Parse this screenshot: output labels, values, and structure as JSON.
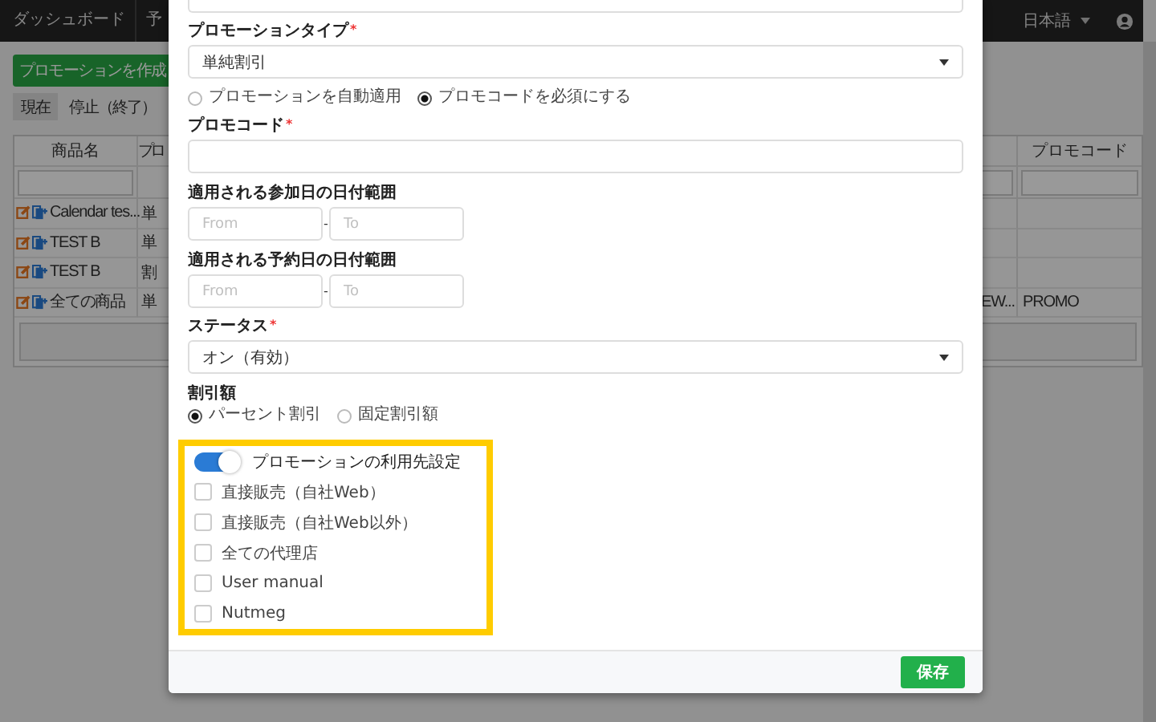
{
  "navbar": {
    "items": [
      {
        "label": "ダッシュボード"
      },
      {
        "label": "予"
      }
    ],
    "language": "日本語"
  },
  "page": {
    "create_button": "プロモーションを作成",
    "tabs": [
      {
        "label": "現在",
        "selected": true
      },
      {
        "label": "停止（終了）",
        "selected": false
      }
    ],
    "table": {
      "header": {
        "name": "商品名",
        "type": "プロ",
        "promo_code": "プロモコード"
      },
      "rows": [
        {
          "name": "Calendar tes...",
          "type": "単"
        },
        {
          "name": "TEST B",
          "type": "単"
        },
        {
          "name": "TEST B",
          "type": "割"
        },
        {
          "name": "全ての商品",
          "type": "単",
          "column_3": "EW...",
          "promo_code": "PROMO"
        }
      ]
    }
  },
  "modal": {
    "fields": [
      {
        "kind": "select",
        "label": "プロモーションタイプ",
        "required_mark": "*",
        "value": "単純割引"
      },
      {
        "kind": "radios",
        "options": [
          {
            "label": "プロモーションを自動適用",
            "selected": false
          },
          {
            "label": "プロモコードを必須にする",
            "selected": true
          }
        ]
      },
      {
        "kind": "text",
        "label": "プロモコード",
        "required_mark": "*"
      },
      {
        "kind": "daterange",
        "label": "適用される参加日の日付範囲",
        "from_placeholder": "From",
        "separator": "-",
        "to_placeholder": "To"
      },
      {
        "kind": "daterange",
        "label": "適用される予約日の日付範囲",
        "from_placeholder": "From",
        "separator": "-",
        "to_placeholder": "To"
      },
      {
        "kind": "select",
        "label": "ステータス",
        "required_mark": "*",
        "value": "オン（有効）"
      },
      {
        "kind": "radios",
        "label": "割引額",
        "options": [
          {
            "label": "パーセント割引",
            "selected": true
          },
          {
            "label": "固定割引額",
            "selected": false
          }
        ]
      },
      {
        "kind": "channels",
        "highlighted": true,
        "toggle": {
          "label": "プロモーションの利用先設定",
          "on": true
        },
        "options": [
          {
            "label": "直接販売（自社Web）",
            "checked": false
          },
          {
            "label": "直接販売（自社Web以外）",
            "checked": false
          },
          {
            "label": "全ての代理店",
            "checked": false
          },
          {
            "label": "User manual",
            "checked": false
          },
          {
            "label": "Nutmeg",
            "checked": false
          }
        ]
      }
    ],
    "save_button": "保存"
  }
}
